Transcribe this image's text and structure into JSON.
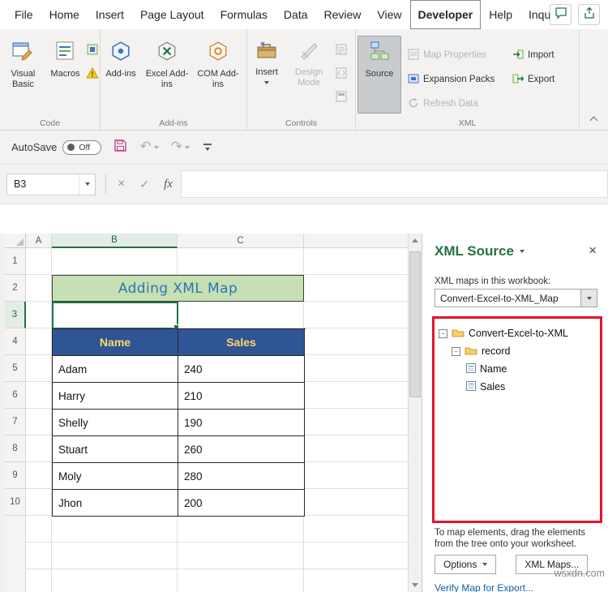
{
  "menubar": {
    "tabs": [
      "File",
      "Home",
      "Insert",
      "Page Layout",
      "Formulas",
      "Data",
      "Review",
      "View",
      "Developer",
      "Help",
      "Inquire"
    ],
    "active_tab": "Developer"
  },
  "ribbon": {
    "groups": {
      "code": {
        "label": "Code",
        "visual_basic": "Visual Basic",
        "macros": "Macros"
      },
      "addins": {
        "label": "Add-ins",
        "addins": "Add-ins",
        "excel_addins": "Excel Add-ins",
        "com_addins": "COM Add-ins"
      },
      "controls": {
        "label": "Controls",
        "insert": "Insert",
        "design_mode": "Design Mode"
      },
      "xml": {
        "label": "XML",
        "source": "Source",
        "map_properties": "Map Properties",
        "expansion_packs": "Expansion Packs",
        "refresh_data": "Refresh Data",
        "import": "Import",
        "export": "Export"
      }
    }
  },
  "quick_access": {
    "autosave_label": "AutoSave",
    "autosave_state": "Off"
  },
  "formula_bar": {
    "name_box": "B3",
    "fx_label": "fx"
  },
  "sheet": {
    "column_headers": [
      "A",
      "B",
      "C"
    ],
    "row_headers": [
      "1",
      "2",
      "3",
      "4",
      "5",
      "6",
      "7",
      "8",
      "9",
      "10"
    ],
    "title_cell": "Adding XML Map",
    "table": {
      "headers": [
        "Name",
        "Sales"
      ],
      "rows": [
        [
          "Adam",
          "240"
        ],
        [
          "Harry",
          "210"
        ],
        [
          "Shelly",
          "190"
        ],
        [
          "Stuart",
          "260"
        ],
        [
          "Moly",
          "280"
        ],
        [
          "Jhon",
          "200"
        ]
      ]
    }
  },
  "xml_panel": {
    "title": "XML Source",
    "maps_label": "XML maps in this workbook:",
    "selected_map": "Convert-Excel-to-XML_Map",
    "tree": {
      "root": "Convert-Excel-to-XML",
      "child": "record",
      "leaves": [
        "Name",
        "Sales"
      ]
    },
    "help_text": "To map elements, drag the elements from the tree onto your worksheet.",
    "options_button": "Options",
    "xml_maps_button": "XML Maps...",
    "verify_link": "Verify Map for Export...",
    "watermark": "wsxdn.com"
  },
  "colors": {
    "excel_green": "#217346",
    "table_header_bg": "#2F5597",
    "table_header_text": "#FFD966",
    "title_bg": "#C6E0B4",
    "title_text": "#2E74B5",
    "tree_border_red": "#E8112D"
  }
}
